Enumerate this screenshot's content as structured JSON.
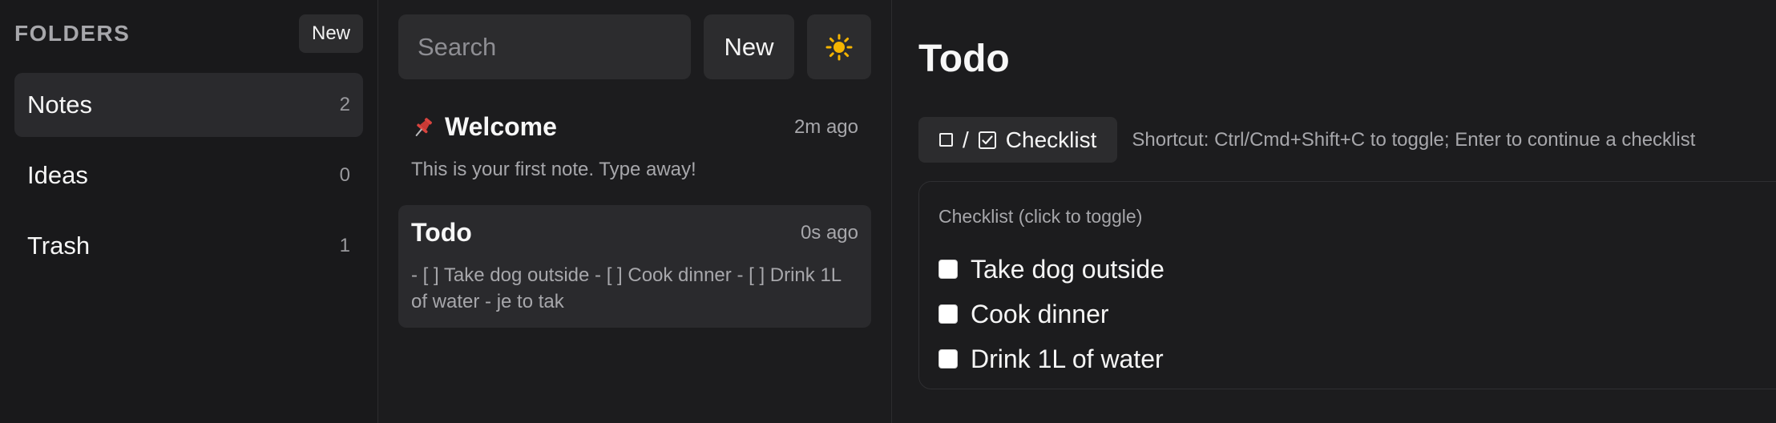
{
  "sidebar": {
    "title": "FOLDERS",
    "new_label": "New",
    "folders": [
      {
        "label": "Notes",
        "count": "2"
      },
      {
        "label": "Ideas",
        "count": "0"
      },
      {
        "label": "Trash",
        "count": "1"
      }
    ]
  },
  "list": {
    "search_placeholder": "Search",
    "new_label": "New",
    "theme_icon": "sun-icon",
    "notes": [
      {
        "icon": "pin-icon",
        "title": "Welcome",
        "time": "2m ago",
        "preview": "This is your first note. Type away!"
      },
      {
        "title": "Todo",
        "time": "0s ago",
        "preview": "- [ ] Take dog outside - [ ] Cook dinner - [ ] Drink 1L of water - je to tak"
      }
    ]
  },
  "editor": {
    "title": "Todo",
    "checklist_button": "Checklist",
    "slash": "/",
    "shortcut": "Shortcut: Ctrl/Cmd+Shift+C to toggle; Enter to continue a checklist",
    "panel_label": "Checklist (click to toggle)",
    "items": [
      {
        "text": "Take dog outside",
        "checked": false
      },
      {
        "text": "Cook dinner",
        "checked": false
      },
      {
        "text": "Drink 1L of water",
        "checked": false
      }
    ]
  },
  "colors": {
    "background": "#1c1c1e",
    "sidebar": "#19191b",
    "surface": "#2c2c2e",
    "active": "#2a2a2d",
    "muted_text": "#a7a7ab",
    "pin": "#d9443f",
    "sun": "#f5b400"
  }
}
